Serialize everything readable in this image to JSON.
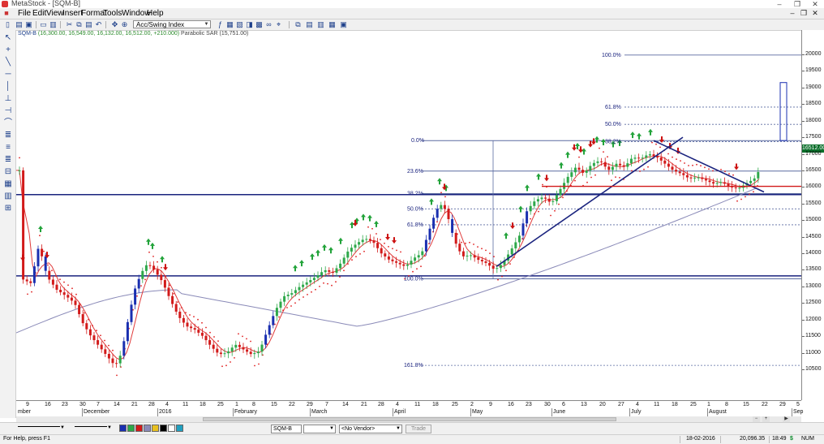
{
  "window": {
    "title": "MetaStock - [SQM-B]",
    "controls": [
      "–",
      "❐",
      "✕"
    ]
  },
  "menu": {
    "items": [
      "File",
      "Edit",
      "View",
      "Insert",
      "Format",
      "Tools",
      "Window",
      "Help"
    ],
    "mdi_controls": [
      "–",
      "❐",
      "✕"
    ]
  },
  "toolbar": {
    "indicator_select": "Acc/Swing Index"
  },
  "chart": {
    "header_symbol": "SQM-B",
    "header_ohlc": "(16,300.00, 16,549.00, 16,132.00, 16,512.00, +210.000)",
    "header_indicator": "Parabolic SAR (15,751.00)",
    "last_price": "16512.00",
    "colors": {
      "up_candle": "#2ea84a",
      "down_candle": "#d21a1a",
      "big_up": "#1a2fb0",
      "sar": "#e02020",
      "ma_fast": "#e03a3a",
      "ma_slow": "#8a8ab8",
      "buy_arrow": "#22a33a",
      "sell_arrow": "#cc1111",
      "support_line": "#1a237e"
    },
    "fib_upper": [
      "100.0%",
      "61.8%",
      "50.0%",
      "38.2%"
    ],
    "fib_main": [
      "0.0%",
      "23.6%",
      "38.2%",
      "50.0%",
      "61.8%",
      "100.0%",
      "161.8%"
    ],
    "y_ticks": [
      "20000",
      "19500",
      "19000",
      "18500",
      "18000",
      "17500",
      "17000",
      "16500",
      "16000",
      "15500",
      "15000",
      "14500",
      "14000",
      "13500",
      "13000",
      "12500",
      "12000",
      "11500",
      "11000",
      "10500"
    ],
    "x_days": [
      "9",
      "16",
      "23",
      "30",
      "7",
      "14",
      "21",
      "28",
      "4",
      "11",
      "18",
      "25",
      "1",
      "8",
      "15",
      "22",
      "29",
      "7",
      "14",
      "21",
      "28",
      "4",
      "11",
      "18",
      "25",
      "2",
      "9",
      "16",
      "23",
      "30",
      "6",
      "13",
      "20",
      "27",
      "4",
      "11",
      "18",
      "25",
      "1",
      "8",
      "15",
      "22",
      "29",
      "5"
    ],
    "x_months": [
      "mber",
      "December",
      "2016",
      "January",
      "February",
      "March",
      "April",
      "May",
      "June",
      "July",
      "August",
      "Sep"
    ]
  },
  "chart_data": {
    "type": "candlestick",
    "symbol": "SQM-B",
    "ylim": [
      10200,
      20300
    ],
    "last": {
      "open": 16300,
      "high": 16549,
      "low": 16132,
      "close": 16512,
      "change": 210
    },
    "parabolic_sar": 15751,
    "horizontal_lines": [
      15770,
      13320
    ],
    "fibonacci_levels": {
      "0.0%": 17400,
      "23.6%": 16480,
      "38.2%": 15800,
      "50.0%": 15340,
      "61.8%": 14860,
      "100.0%": 13230,
      "161.8%": 10620
    },
    "fibonacci_upper": {
      "100.0%": 19980,
      "61.8%": 18410,
      "50.0%": 17890,
      "38.2%": 17370
    }
  },
  "left_tools": [
    "↖",
    "+",
    "╲",
    "─",
    "│",
    "⊥",
    "⊣",
    "⌒",
    "≣",
    "≡",
    "≣",
    "⊟",
    "▦",
    "▥",
    "⊞"
  ],
  "bottom": {
    "symbol_field": "SQM-B",
    "vendor_select": "<No Vendor>",
    "trade_label": "Trade"
  },
  "status": {
    "help": "For Help, press F1",
    "date": "18-02-2016",
    "value": "20,096.35",
    "time": "18:49",
    "symbol": "$",
    "mode": "NUM"
  }
}
